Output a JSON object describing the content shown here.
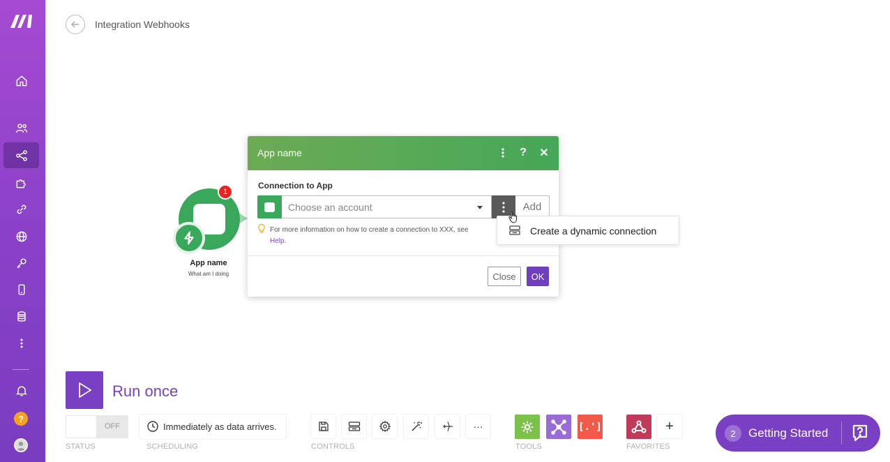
{
  "sidebar": {
    "logo": "make-logo",
    "items": [
      {
        "name": "home-icon"
      },
      {
        "name": "team-icon"
      },
      {
        "name": "share-icon",
        "active": true
      },
      {
        "name": "puzzle-icon"
      },
      {
        "name": "link-icon"
      },
      {
        "name": "globe-icon"
      },
      {
        "name": "key-icon"
      },
      {
        "name": "phone-icon"
      },
      {
        "name": "database-icon"
      },
      {
        "name": "more-vertical-icon"
      }
    ],
    "bell": "bell-icon",
    "help_label": "?",
    "avatar": "avatar"
  },
  "header": {
    "title": "Integration Webhooks"
  },
  "module": {
    "name": "App name",
    "subtitle": "What am I doing",
    "badge_count": "1",
    "color": "#3aa85a"
  },
  "dialog": {
    "title": "App name",
    "help_icon_label": "?",
    "close_icon_label": "✕",
    "connection_label": "Connection to App",
    "account_placeholder": "Choose an account",
    "add_label": "Add",
    "hint_text": "For more information on how to create a connection to XXX, see",
    "hint_link": "Help.",
    "close_label": "Close",
    "ok_label": "OK",
    "header_color": "#45a858"
  },
  "dropdown": {
    "label": "Create a dynamic connection"
  },
  "bottom": {
    "run_label": "Run once",
    "toggle_label": "OFF",
    "status_caption": "STATUS",
    "scheduling_text": "Immediately as data arrives.",
    "scheduling_caption": "SCHEDULING",
    "controls_caption": "CONTROLS",
    "controls": [
      "save-icon",
      "notes-icon",
      "settings-icon",
      "magic-wand-icon",
      "airplane-icon",
      "ellipsis-icon"
    ],
    "ellipsis_label": "···",
    "tools_caption": "TOOLS",
    "tools": [
      {
        "name": "tools-gear-icon",
        "color": "#7cc24a"
      },
      {
        "name": "flow-control-icon",
        "color": "#9a6bd6"
      },
      {
        "name": "text-parser-icon",
        "color": "#f05a4a",
        "label": "[.']"
      }
    ],
    "favorites_caption": "FAVORITES",
    "favorites": [
      {
        "name": "webhooks-icon",
        "color": "#c03a5a"
      }
    ],
    "add_favorite_label": "+",
    "accent": "#7a40c4"
  },
  "getting_started": {
    "count": "2",
    "label": "Getting Started"
  }
}
